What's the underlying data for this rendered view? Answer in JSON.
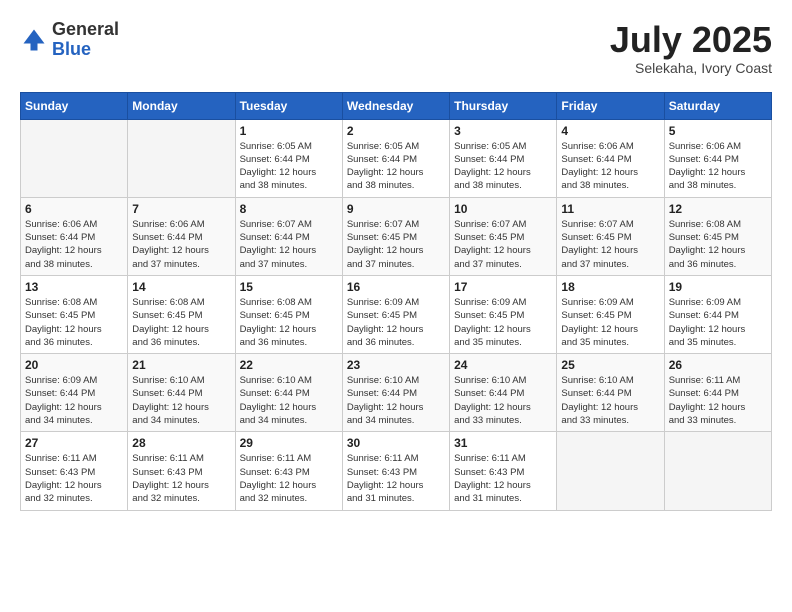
{
  "header": {
    "logo": {
      "general": "General",
      "blue": "Blue"
    },
    "title": "July 2025",
    "subtitle": "Selekaha, Ivory Coast"
  },
  "weekdays": [
    "Sunday",
    "Monday",
    "Tuesday",
    "Wednesday",
    "Thursday",
    "Friday",
    "Saturday"
  ],
  "weeks": [
    [
      null,
      null,
      {
        "day": "1",
        "sunrise": "6:05 AM",
        "sunset": "6:44 PM",
        "daylight": "12 hours and 38 minutes."
      },
      {
        "day": "2",
        "sunrise": "6:05 AM",
        "sunset": "6:44 PM",
        "daylight": "12 hours and 38 minutes."
      },
      {
        "day": "3",
        "sunrise": "6:05 AM",
        "sunset": "6:44 PM",
        "daylight": "12 hours and 38 minutes."
      },
      {
        "day": "4",
        "sunrise": "6:06 AM",
        "sunset": "6:44 PM",
        "daylight": "12 hours and 38 minutes."
      },
      {
        "day": "5",
        "sunrise": "6:06 AM",
        "sunset": "6:44 PM",
        "daylight": "12 hours and 38 minutes."
      }
    ],
    [
      {
        "day": "6",
        "sunrise": "6:06 AM",
        "sunset": "6:44 PM",
        "daylight": "12 hours and 38 minutes."
      },
      {
        "day": "7",
        "sunrise": "6:06 AM",
        "sunset": "6:44 PM",
        "daylight": "12 hours and 37 minutes."
      },
      {
        "day": "8",
        "sunrise": "6:07 AM",
        "sunset": "6:44 PM",
        "daylight": "12 hours and 37 minutes."
      },
      {
        "day": "9",
        "sunrise": "6:07 AM",
        "sunset": "6:45 PM",
        "daylight": "12 hours and 37 minutes."
      },
      {
        "day": "10",
        "sunrise": "6:07 AM",
        "sunset": "6:45 PM",
        "daylight": "12 hours and 37 minutes."
      },
      {
        "day": "11",
        "sunrise": "6:07 AM",
        "sunset": "6:45 PM",
        "daylight": "12 hours and 37 minutes."
      },
      {
        "day": "12",
        "sunrise": "6:08 AM",
        "sunset": "6:45 PM",
        "daylight": "12 hours and 36 minutes."
      }
    ],
    [
      {
        "day": "13",
        "sunrise": "6:08 AM",
        "sunset": "6:45 PM",
        "daylight": "12 hours and 36 minutes."
      },
      {
        "day": "14",
        "sunrise": "6:08 AM",
        "sunset": "6:45 PM",
        "daylight": "12 hours and 36 minutes."
      },
      {
        "day": "15",
        "sunrise": "6:08 AM",
        "sunset": "6:45 PM",
        "daylight": "12 hours and 36 minutes."
      },
      {
        "day": "16",
        "sunrise": "6:09 AM",
        "sunset": "6:45 PM",
        "daylight": "12 hours and 36 minutes."
      },
      {
        "day": "17",
        "sunrise": "6:09 AM",
        "sunset": "6:45 PM",
        "daylight": "12 hours and 35 minutes."
      },
      {
        "day": "18",
        "sunrise": "6:09 AM",
        "sunset": "6:45 PM",
        "daylight": "12 hours and 35 minutes."
      },
      {
        "day": "19",
        "sunrise": "6:09 AM",
        "sunset": "6:44 PM",
        "daylight": "12 hours and 35 minutes."
      }
    ],
    [
      {
        "day": "20",
        "sunrise": "6:09 AM",
        "sunset": "6:44 PM",
        "daylight": "12 hours and 34 minutes."
      },
      {
        "day": "21",
        "sunrise": "6:10 AM",
        "sunset": "6:44 PM",
        "daylight": "12 hours and 34 minutes."
      },
      {
        "day": "22",
        "sunrise": "6:10 AM",
        "sunset": "6:44 PM",
        "daylight": "12 hours and 34 minutes."
      },
      {
        "day": "23",
        "sunrise": "6:10 AM",
        "sunset": "6:44 PM",
        "daylight": "12 hours and 34 minutes."
      },
      {
        "day": "24",
        "sunrise": "6:10 AM",
        "sunset": "6:44 PM",
        "daylight": "12 hours and 33 minutes."
      },
      {
        "day": "25",
        "sunrise": "6:10 AM",
        "sunset": "6:44 PM",
        "daylight": "12 hours and 33 minutes."
      },
      {
        "day": "26",
        "sunrise": "6:11 AM",
        "sunset": "6:44 PM",
        "daylight": "12 hours and 33 minutes."
      }
    ],
    [
      {
        "day": "27",
        "sunrise": "6:11 AM",
        "sunset": "6:43 PM",
        "daylight": "12 hours and 32 minutes."
      },
      {
        "day": "28",
        "sunrise": "6:11 AM",
        "sunset": "6:43 PM",
        "daylight": "12 hours and 32 minutes."
      },
      {
        "day": "29",
        "sunrise": "6:11 AM",
        "sunset": "6:43 PM",
        "daylight": "12 hours and 32 minutes."
      },
      {
        "day": "30",
        "sunrise": "6:11 AM",
        "sunset": "6:43 PM",
        "daylight": "12 hours and 31 minutes."
      },
      {
        "day": "31",
        "sunrise": "6:11 AM",
        "sunset": "6:43 PM",
        "daylight": "12 hours and 31 minutes."
      },
      null,
      null
    ]
  ]
}
